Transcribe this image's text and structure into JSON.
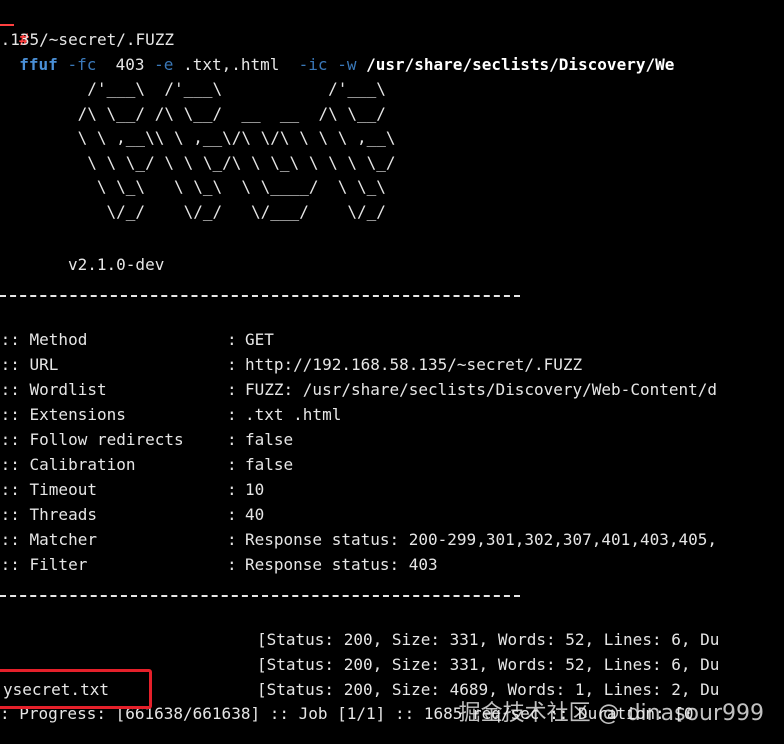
{
  "command": {
    "prompt_symbol": "#",
    "tool": "ffuf",
    "flag_fc": "-fc",
    "fc_value": "403",
    "flag_e": "-e",
    "e_value": ".txt,.html",
    "flag_ic": "-ic",
    "flag_w": "-w",
    "w_value": "/usr/share/seclists/Discovery/We"
  },
  "url_line": "8.135/~secret/.FUZZ",
  "banner": {
    "ascii_art": "  /'___\\  /'___\\           /'___\\\n /\\ \\__/ /\\ \\__/  __  __  /\\ \\__/\n \\ \\ ,__\\\\ \\ ,__\\/\\ \\/\\ \\ \\ \\ ,__\\\n  \\ \\ \\_/ \\ \\ \\_/\\ \\ \\_\\ \\ \\ \\ \\_/\n   \\ \\_\\   \\ \\_\\  \\ \\____/  \\ \\_\\\n    \\/_/    \\/_/   \\/___/    \\/_/",
    "version": "v2.1.0-dev"
  },
  "config": [
    {
      "key": " :: Method",
      "value": "GET"
    },
    {
      "key": " :: URL",
      "value": "http://192.168.58.135/~secret/.FUZZ"
    },
    {
      "key": " :: Wordlist",
      "value": "FUZZ: /usr/share/seclists/Discovery/Web-Content/d"
    },
    {
      "key": " :: Extensions",
      "value": ".txt .html"
    },
    {
      "key": " :: Follow redirects",
      "value": "false"
    },
    {
      "key": " :: Calibration",
      "value": "false"
    },
    {
      "key": " :: Timeout",
      "value": "10"
    },
    {
      "key": " :: Threads",
      "value": "40"
    },
    {
      "key": " :: Matcher",
      "value": "Response status: 200-299,301,302,307,401,403,405,"
    },
    {
      "key": " :: Filter",
      "value": "Response status: 403"
    }
  ],
  "config_colon": ":",
  "results": [
    {
      "name": "",
      "status": "[Status: 200, Size: 331, Words: 52, Lines: 6, Du"
    },
    {
      "name": "",
      "status": "[Status: 200, Size: 331, Words: 52, Lines: 6, Du"
    },
    {
      "name": "ysecret.txt",
      "status": "[Status: 200, Size: 4689, Words: 1, Lines: 2, Du"
    }
  ],
  "progress_line": ": Progress: [661638/661638] :: Job [1/1] :: 1685 req/sec :: Duration: [0",
  "watermark": "掘金技术社区 @ dinasour999",
  "colors": {
    "background": "#000000",
    "prompt": "#ff4040",
    "command": "#4a8fd6",
    "highlight_box": "#e5202a"
  }
}
